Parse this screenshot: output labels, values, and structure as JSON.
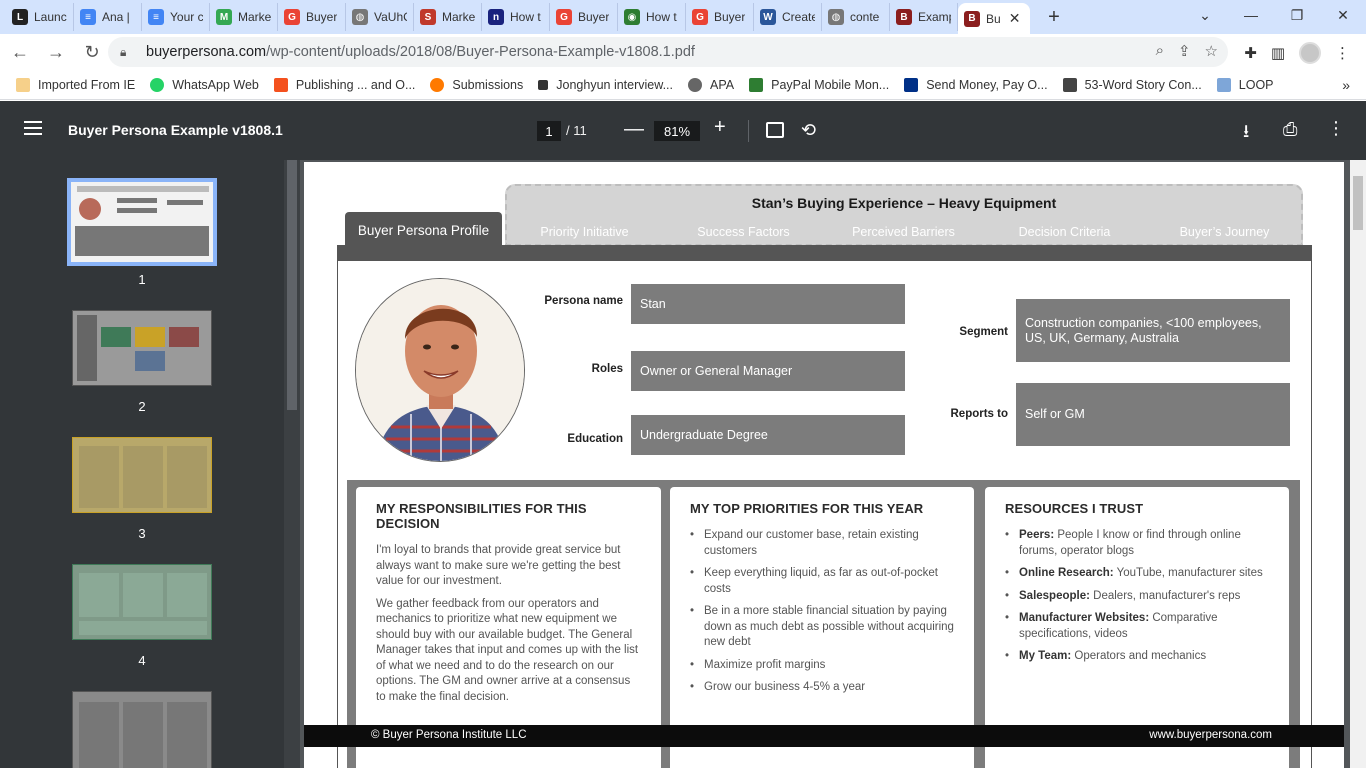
{
  "browser": {
    "tabs": [
      {
        "label": "Launc",
        "color": "#222"
      },
      {
        "label": "Ana |",
        "color": "#4285f4"
      },
      {
        "label": "Your c",
        "color": "#4285f4"
      },
      {
        "label": "Marke",
        "color": "#34a853"
      },
      {
        "label": "Buyer",
        "color": "#ea4335"
      },
      {
        "label": "VaUhC",
        "color": "#777"
      },
      {
        "label": "Marke",
        "color": "#c0392b"
      },
      {
        "label": "How t",
        "color": "#1a237e"
      },
      {
        "label": "Buyer",
        "color": "#ea4335"
      },
      {
        "label": "How t",
        "color": "#2e7d32"
      },
      {
        "label": "Buyer",
        "color": "#ea4335"
      },
      {
        "label": "Create",
        "color": "#2b579a"
      },
      {
        "label": "conte",
        "color": "#777"
      },
      {
        "label": "Examp",
        "color": "#8b1e1e"
      }
    ],
    "active_tab": {
      "label": "Bu",
      "close": "✕"
    },
    "new_tab": "+",
    "url_host": "buyerpersona.com",
    "url_path": "/wp-content/uploads/2018/08/Buyer-Persona-Example-v1808.1.pdf",
    "bookmarks": [
      {
        "label": "Imported From IE",
        "color": "#f4b400"
      },
      {
        "label": "WhatsApp Web",
        "color": "#25d366"
      },
      {
        "label": "Publishing ... and O...",
        "color": "#f4511e"
      },
      {
        "label": "Submissions",
        "color": "#ff7a00"
      },
      {
        "label": "Jonghyun interview...",
        "color": "#333"
      },
      {
        "label": "APA",
        "color": "#666"
      },
      {
        "label": "PayPal Mobile Mon...",
        "color": "#2e7d32"
      },
      {
        "label": "Send Money, Pay O...",
        "color": "#003087"
      },
      {
        "label": "53-Word Story Con...",
        "color": "#444"
      },
      {
        "label": "LOOP",
        "color": "#7ea6d8"
      }
    ],
    "bookmarks_more": "»"
  },
  "pdf_viewer": {
    "title": "Buyer Persona Example v1808.1",
    "current_page": "1",
    "total_pages": "/ 11",
    "zoom": "81%",
    "zoom_out": "—",
    "zoom_in": "+",
    "thumbnails": [
      "1",
      "2",
      "3",
      "4"
    ]
  },
  "document": {
    "header_title": "Stan’s Buying Experience – Heavy Equipment",
    "profile_tab": "Buyer Persona Profile",
    "tabs": [
      {
        "label": "Priority Initiative",
        "color": "#c9a227"
      },
      {
        "label": "Success Factors",
        "color": "#3f7a58"
      },
      {
        "label": "Perceived Barriers",
        "color": "#3b3b3b"
      },
      {
        "label": "Decision Criteria",
        "color": "#5b7394"
      },
      {
        "label": "Buyer’s Journey",
        "color": "#8b4a48"
      }
    ],
    "fields": {
      "persona_name_label": "Persona name",
      "persona_name": "Stan",
      "roles_label": "Roles",
      "roles": "Owner or General Manager",
      "education_label": "Education",
      "education": "Undergraduate Degree",
      "segment_label": "Segment",
      "segment": "Construction companies, <100 employees, US, UK, Germany, Australia",
      "reports_to_label": "Reports to",
      "reports_to": "Self or GM"
    },
    "responsibilities": {
      "title": "MY RESPONSIBILITIES FOR THIS DECISION",
      "p1": "I'm loyal to brands that provide great service but always want to make sure we're getting the best value for our investment.",
      "p2": "We gather feedback from our operators and mechanics to prioritize what new equipment we should buy with our available budget. The General Manager takes that input and comes up with the list of what we need and to do the research on our options. The GM and owner arrive at a consensus to make the final decision."
    },
    "priorities": {
      "title": "MY TOP PRIORITIES FOR THIS YEAR",
      "items": [
        "Expand our customer base, retain existing customers",
        "Keep everything liquid, as far as out-of-pocket costs",
        "Be in a more stable financial situation by paying down as much debt as possible without acquiring new debt",
        "Maximize profit margins",
        "Grow our business 4-5% a year"
      ]
    },
    "resources": {
      "title": "RESOURCES I TRUST",
      "items": [
        {
          "label": "Peers:",
          "text": " People I know or find through online forums, operator blogs"
        },
        {
          "label": "Online Research:",
          "text": " YouTube, manufacturer sites"
        },
        {
          "label": "Salespeople:",
          "text": " Dealers, manufacturer's reps"
        },
        {
          "label": "Manufacturer Websites:",
          "text": " Comparative specifications, videos"
        },
        {
          "label": "My Team:",
          "text": " Operators and mechanics"
        }
      ]
    },
    "footer_left": "© Buyer Persona Institute LLC",
    "footer_right": "www.buyerpersona.com"
  }
}
